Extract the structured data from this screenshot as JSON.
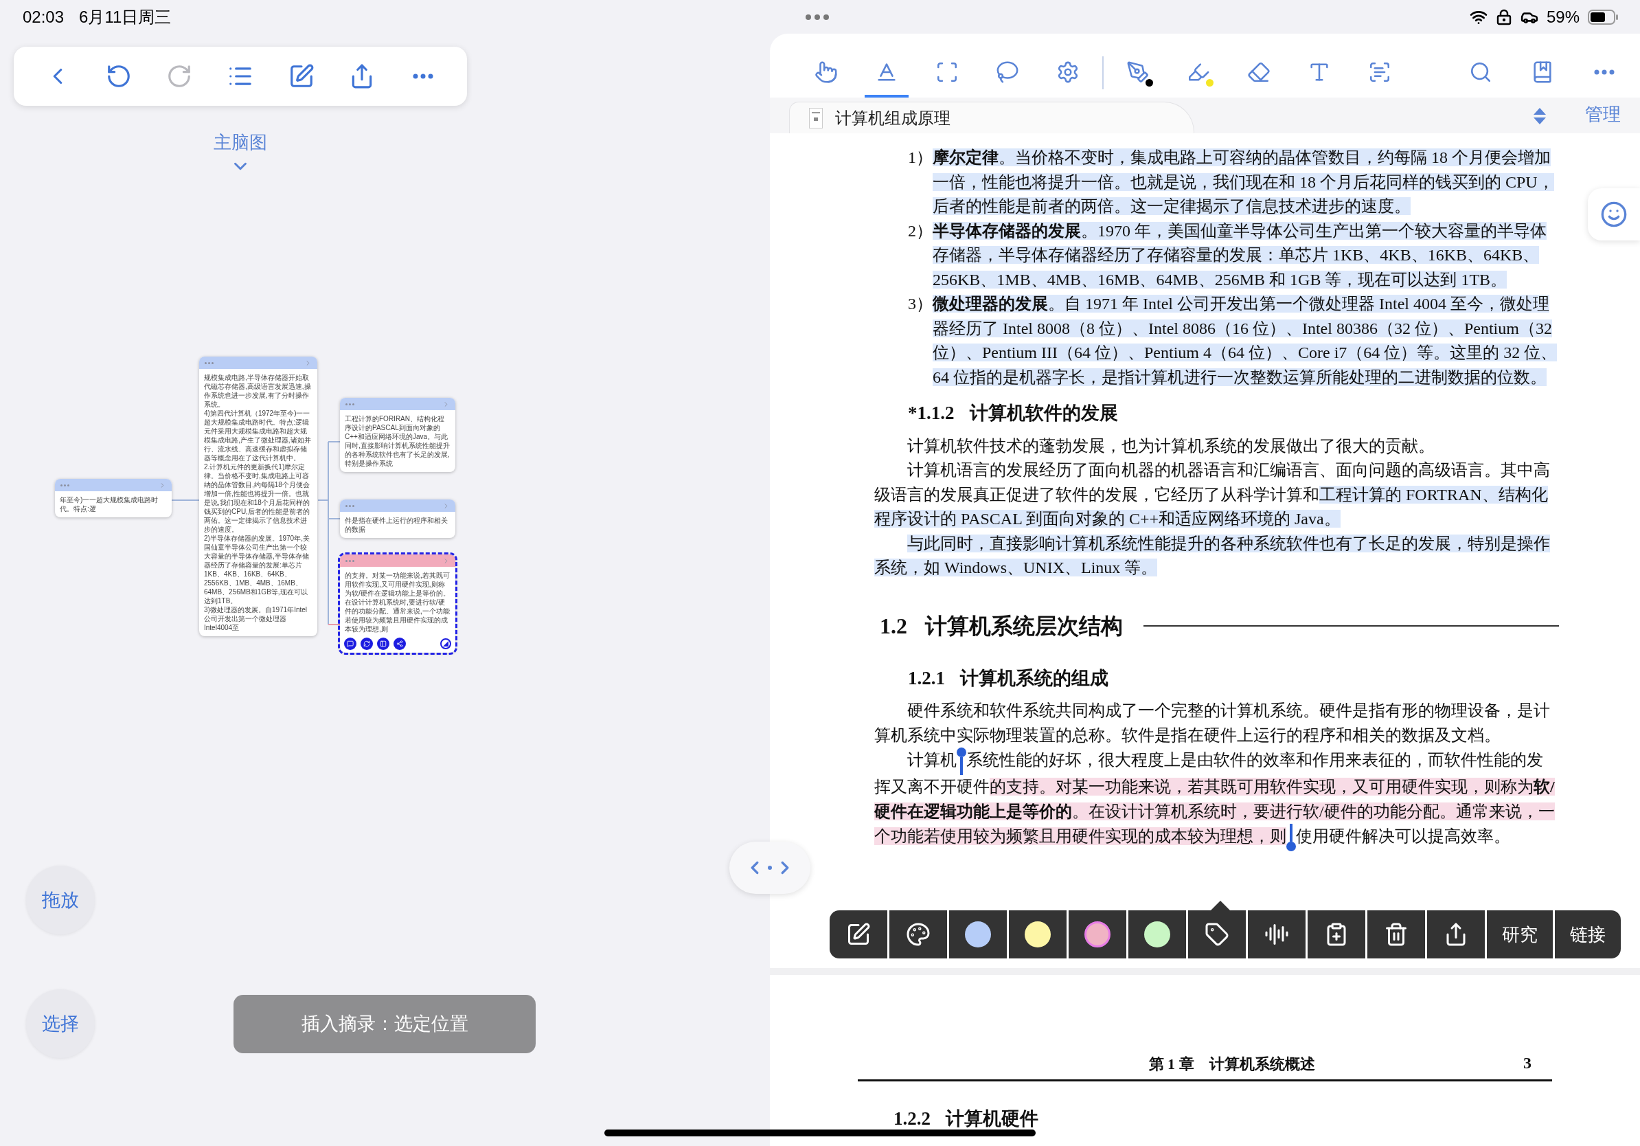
{
  "status_bar": {
    "time": "02:03",
    "date": "6月11日周三",
    "battery": "59%"
  },
  "left_toolbar": [
    {
      "kind": "back",
      "disabled": false
    },
    {
      "kind": "undo",
      "disabled": false
    },
    {
      "kind": "redo",
      "disabled": true
    },
    {
      "kind": "outline",
      "disabled": false
    },
    {
      "kind": "edit",
      "disabled": false
    },
    {
      "kind": "share",
      "disabled": false
    },
    {
      "kind": "more",
      "disabled": false
    }
  ],
  "mindmap": {
    "title": "主脑图",
    "nodes": [
      {
        "text": "年至今)一一超大规模集成电路时代。特点:逻",
        "color": "#b9cdf5",
        "selected": false
      },
      {
        "text": "规模集成电路,半导体存储器开始取代磁芯存储器,高级语言发展迅速,操作系统也进一步发展,有了分时操作系统。\n4)第四代计算机（1972年至今)一一超大规模集成电路时代。特点:逻辑元件采用大规模集成电路和超大规模集成电路,产生了微处理器,诸如并行、流水线、高速缓存和虚拟存储器等概念用在了这代计算机中。\n2.计算机元件的更新换代1)摩尔定律。当价格不变时,集成电路上可容纳的晶体管数目,约每隔18个月便会增加一倍,性能也将提升一倍。也就是说,我们现在和18个月后花同样的钱买到的CPU,后者的性能是前者的两佑。这一定律揭示了信息技术进步的速度。\n2)半导体存储器的发展。1970年,美国仙童半导体公司生产出第一个较大容量的半导体存储器,半导体存储器经历了存储容量的发展:单芯片1KB、4KB、16KB、64KB、2556KB、1MB、4MB、16MB、64MB、256MB和1GB等,现在可以达到1TB。\n3)微处理器的发展。自1971年Intel公司开发出第一个微处理器Intel4004至",
        "color": "#b9cdf5",
        "selected": false
      },
      {
        "text": "工程计算的FORIRAN、结构化程序设计的PASCAL到面向对象的C++和适应网络环境的Java。与此同时,直接影响计算机系统性能提升的各种系统软件也有了长足的发展,特别是操作系统",
        "color": "#b9cdf5",
        "selected": false
      },
      {
        "text": "件是指在硬件上运行的程序和相关的数据",
        "color": "#b9cdf5",
        "selected": false
      },
      {
        "text": "的支持。对某一功能来说,若其既可用软件实现,又可用硬件实现,则称为软/硬件在逻辑功能上是等价的。在设计计算机系统时,要进行软/硬件的功能分配。通常来说,一个功能若使用较为频繁且用硬件实现的成本较为理想,则",
        "color": "#f2aabb",
        "selected": true
      }
    ]
  },
  "left_buttons": {
    "drag": "拖放",
    "select": "选择",
    "insert": "插入摘录：选定位置"
  },
  "tools": {
    "select_tools": [
      {
        "kind": "hand",
        "selected": false
      },
      {
        "kind": "text",
        "selected": true
      },
      {
        "kind": "rect",
        "selected": false
      },
      {
        "kind": "lasso",
        "selected": false
      },
      {
        "kind": "settings",
        "selected": false
      }
    ],
    "draw_tools": [
      {
        "kind": "pen",
        "color": "#000000",
        "selected": false
      },
      {
        "kind": "highlighter",
        "color": "#f5e625",
        "selected": false
      },
      {
        "kind": "eraser",
        "selected": false
      },
      {
        "kind": "textbox",
        "selected": false
      },
      {
        "kind": "textscan",
        "selected": false
      }
    ],
    "right_tools": [
      {
        "kind": "search"
      },
      {
        "kind": "bookmark"
      },
      {
        "kind": "more"
      }
    ]
  },
  "document": {
    "tab_title": "计算机组成原理",
    "manage": "管理",
    "blocks": [
      {
        "kind": "item",
        "number": "1）",
        "segments": [
          {
            "text": "**摩尔定律**。当价格不变时，集成电路上可容纳的晶体管数目，约每隔 18 个月便会增加一倍，性能也将提升一倍。也就是说，我们现在和 18 个月后花同样的钱买到的 CPU，后者的性能是前者的两倍。这一定律揭示了信息技术进步的速度。",
            "color": "#dce8fb"
          }
        ]
      },
      {
        "kind": "item",
        "number": "2）",
        "segments": [
          {
            "text": "**半导体存储器的发展**。1970 年，美国仙童半导体公司生产出第一个较大容量的半导体存储器，半导体存储器经历了存储容量的发展：单芯片 1KB、4KB、16KB、64KB、256KB、1MB、4MB、16MB、64MB、256MB 和 1GB 等，现在可以达到 1TB。",
            "color": "#dce8fb"
          }
        ]
      },
      {
        "kind": "item",
        "number": "3）",
        "segments": [
          {
            "text": "**微处理器的发展**。自 1971 年 Intel 公司开发出第一个微处理器 Intel 4004 至今，微处理器经历了 Intel 8008（8 位）、Intel 8086（16 位）、Intel 80386（32 位）、Pentium（32 位）、Pentium III（64 位）、Pentium 4（64 位）、Core i7（64 位）等。这里的 32 位、64 位指的是机器字长，是指计算机进行一次整数运算所能处理的二进制数据的位数。",
            "color": "#dce8fb"
          }
        ]
      },
      {
        "kind": "subsection",
        "number": "*1.1.2",
        "title": "计算机软件的发展"
      },
      {
        "kind": "para",
        "segments": [
          {
            "text": "计算机软件技术的蓬勃发展，也为计算机系统的发展做出了很大的贡献。"
          }
        ]
      },
      {
        "kind": "para",
        "segments": [
          {
            "text": "计算机语言的发展经历了面向机器的机器语言和汇编语言、面向问题的高级语言。其中高级语言的发展真正促进了软件的发展，它经历了从科学计算和"
          },
          {
            "text": "工程计算的 FORTRAN、结构化程序设计的 PASCAL 到面向对象的 C++和适应网络环境的 Java。",
            "color": "#dce8fb"
          }
        ]
      },
      {
        "kind": "para",
        "segments": [
          {
            "text": "与此同时，直接影响计算机系统性能提升的各种系统软件也有了长足的发展，特别是操作系统，如 Windows、UNIX、Linux 等。",
            "color": "#dce8fb"
          }
        ]
      },
      {
        "kind": "section",
        "number": "1.2",
        "title": "计算机系统层次结构"
      },
      {
        "kind": "subsection",
        "number": "1.2.1",
        "title": "计算机系统的组成"
      },
      {
        "kind": "para",
        "segments": [
          {
            "text": "硬件系统和软件系统共同构成了一个完整的计算机系统。硬件是指有形的物理设备，是计算机系统中实际物理装置的总称。软件是指在硬件上运行的程序和相关的数据及文档。"
          }
        ]
      },
      {
        "kind": "para",
        "segments": [
          {
            "text": "计算机"
          },
          {
            "text": "系统性能的好坏，很大程度上是由软件的效率和作用来表征的，而软件性能的发挥又离不开硬件",
            "selection_start": true
          },
          {
            "text": "的支持。对某一功能来说，若其既可用软件实现，又可用硬件实现，则称为**软/硬件在逻辑功能上是等价的**。在设计计算机系统时，要进行软/硬件的功能分配。通常来说，一个功能若使用较为频繁且用硬件实现的成本较为理想，则",
            "color": "#f8dce6",
            "selection_end": true
          },
          {
            "text": "使用硬件解决可以提高效率。"
          }
        ]
      }
    ],
    "footer": {
      "chapter": "第 1 章　计算机系统概述",
      "page": "3"
    },
    "next_heading": {
      "number": "1.2.2",
      "title": "计算机硬件"
    }
  },
  "popup_menu": [
    {
      "kind": "edit"
    },
    {
      "kind": "palette"
    },
    {
      "kind": "color",
      "color": "#b6cdf8",
      "selected": false
    },
    {
      "kind": "color",
      "color": "#fdf6a6",
      "selected": false
    },
    {
      "kind": "color",
      "color": "#f0b3c4",
      "selected": true
    },
    {
      "kind": "color",
      "color": "#c9f6c4",
      "selected": false
    },
    {
      "kind": "tag"
    },
    {
      "kind": "speak"
    },
    {
      "kind": "clipboard"
    },
    {
      "kind": "trash"
    },
    {
      "kind": "share"
    },
    {
      "kind": "label",
      "label": "研究"
    },
    {
      "kind": "label",
      "label": "链接"
    }
  ]
}
